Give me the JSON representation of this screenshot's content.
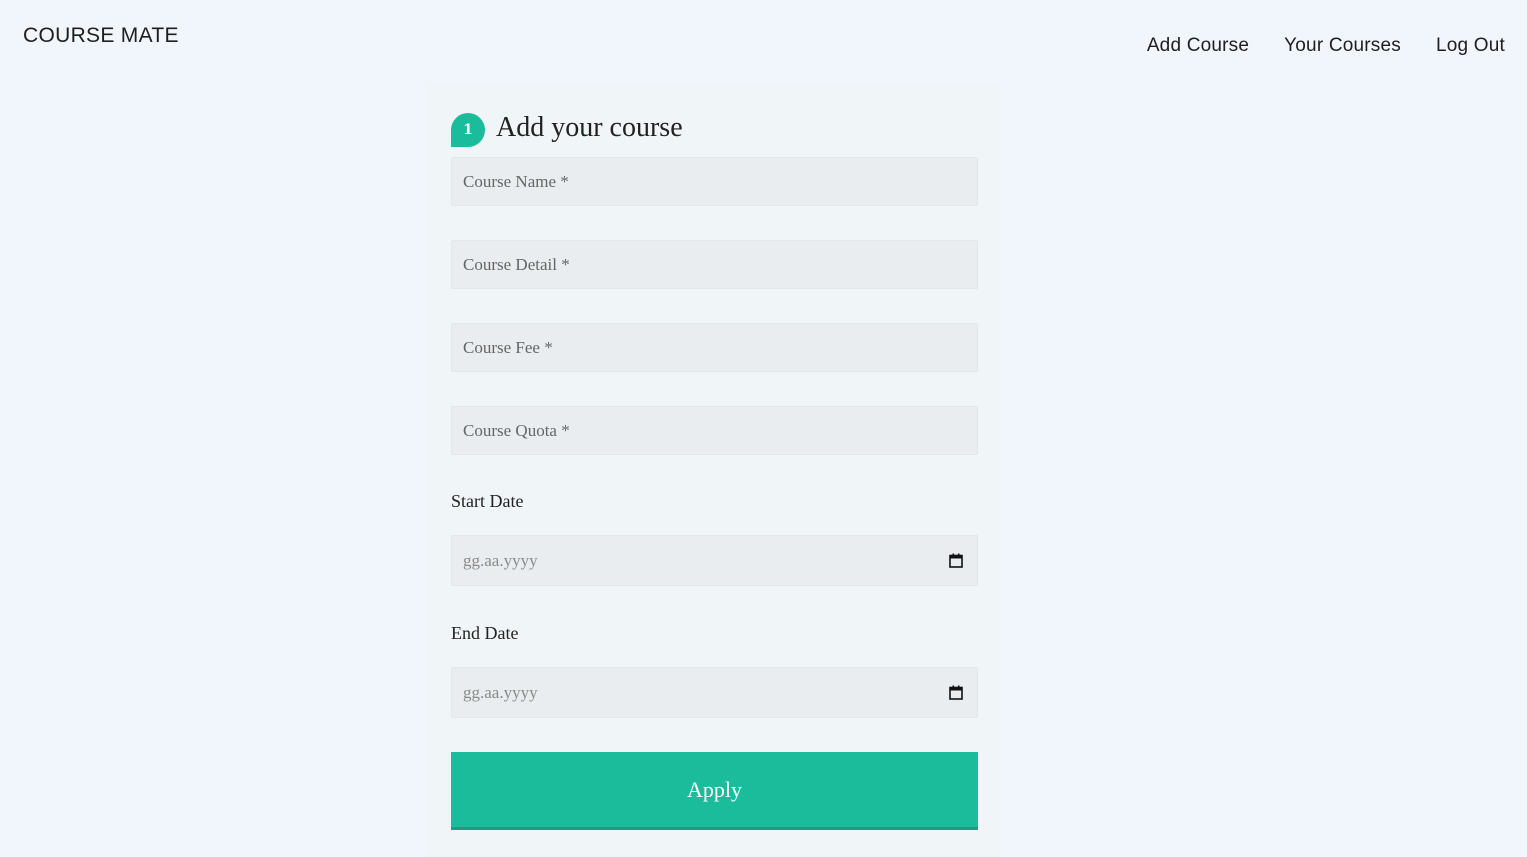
{
  "header": {
    "brand": "COURSE MATE",
    "nav": [
      {
        "label": "Add Course"
      },
      {
        "label": "Your Courses"
      },
      {
        "label": "Log Out"
      }
    ]
  },
  "form": {
    "step_number": "1",
    "title": "Add your course",
    "fields": {
      "course_name": {
        "placeholder": "Course Name *",
        "value": ""
      },
      "course_detail": {
        "placeholder": "Course Detail *",
        "value": ""
      },
      "course_fee": {
        "placeholder": "Course Fee *",
        "value": ""
      },
      "course_quota": {
        "placeholder": "Course Quota *",
        "value": ""
      }
    },
    "start_date": {
      "label": "Start Date",
      "placeholder": "gg.aa.yyyy"
    },
    "end_date": {
      "label": "End Date",
      "placeholder": "gg.aa.yyyy"
    },
    "submit_label": "Apply"
  },
  "icons": {
    "date_picker": "calendar-icon"
  },
  "colors": {
    "page_background": "#f0f6fc",
    "panel_background": "#f0f5f7",
    "accent": "#1abc9c",
    "accent_dark": "#16a085",
    "input_background": "#e9edef"
  }
}
